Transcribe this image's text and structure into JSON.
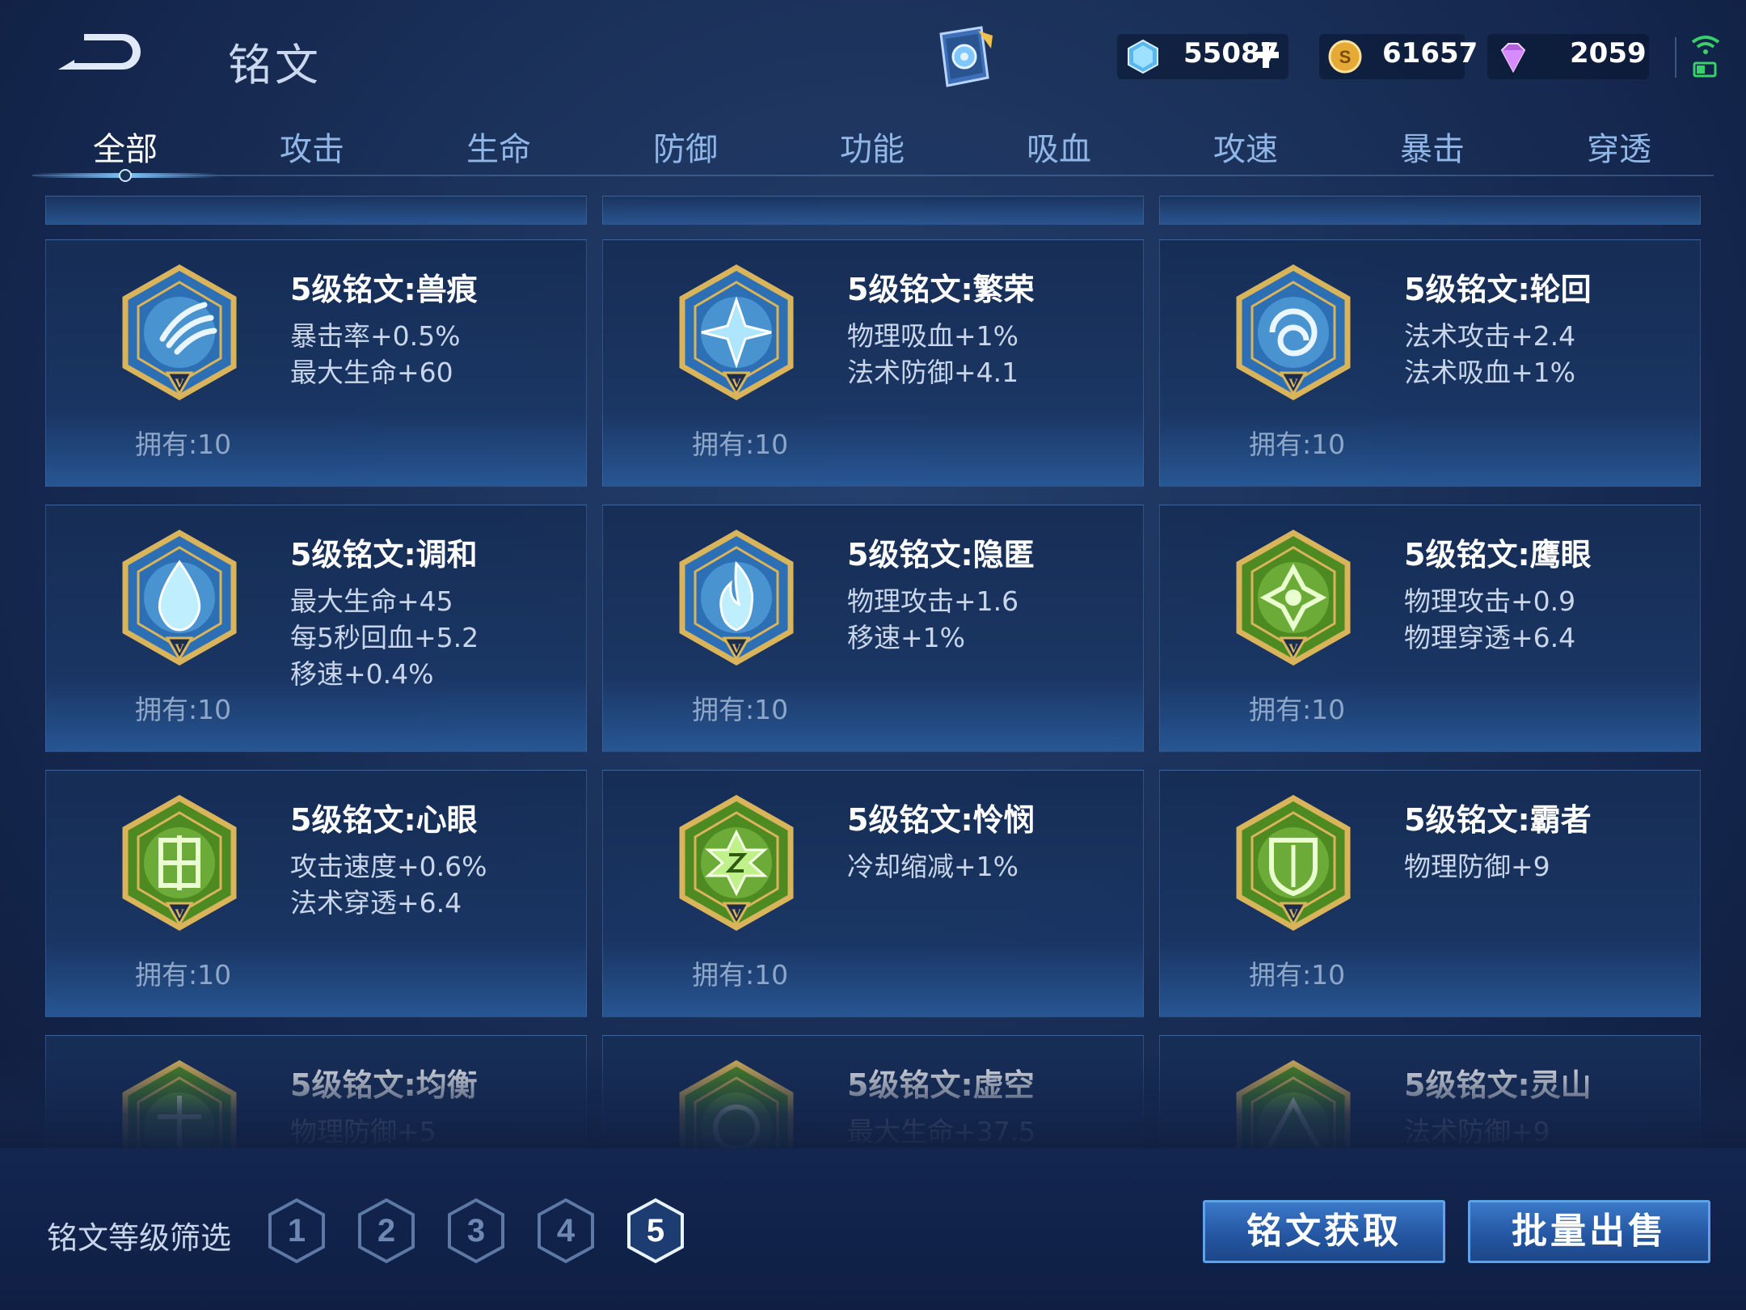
{
  "header": {
    "title": "铭文",
    "currencies": [
      {
        "icon": "diamond-crystal-icon",
        "value": "55087",
        "has_plus": true
      },
      {
        "icon": "gold-coin-icon",
        "value": "61657",
        "has_plus": false
      },
      {
        "icon": "purple-gem-icon",
        "value": "2059",
        "has_plus": false
      }
    ]
  },
  "tabs": [
    {
      "label": "全部",
      "active": true
    },
    {
      "label": "攻击"
    },
    {
      "label": "生命"
    },
    {
      "label": "防御"
    },
    {
      "label": "功能"
    },
    {
      "label": "吸血"
    },
    {
      "label": "攻速"
    },
    {
      "label": "暴击"
    },
    {
      "label": "穿透"
    }
  ],
  "cards": [
    {
      "name": "5级铭文:兽痕",
      "attrs": [
        "暴击率+0.5%",
        "最大生命+60"
      ],
      "owned": "拥有:10",
      "color": "blue",
      "icon": "claw-marks-icon"
    },
    {
      "name": "5级铭文:繁荣",
      "attrs": [
        "物理吸血+1%",
        "法术防御+4.1"
      ],
      "owned": "拥有:10",
      "color": "blue",
      "icon": "star-compass-icon"
    },
    {
      "name": "5级铭文:轮回",
      "attrs": [
        "法术攻击+2.4",
        "法术吸血+1%"
      ],
      "owned": "拥有:10",
      "color": "blue",
      "icon": "swirl-icon"
    },
    {
      "name": "5级铭文:调和",
      "attrs": [
        "最大生命+45",
        "每5秒回血+5.2",
        "移速+0.4%"
      ],
      "owned": "拥有:10",
      "color": "blue",
      "icon": "water-drop-icon"
    },
    {
      "name": "5级铭文:隐匿",
      "attrs": [
        "物理攻击+1.6",
        "移速+1%"
      ],
      "owned": "拥有:10",
      "color": "blue",
      "icon": "flame-icon"
    },
    {
      "name": "5级铭文:鹰眼",
      "attrs": [
        "物理攻击+0.9",
        "物理穿透+6.4"
      ],
      "owned": "拥有:10",
      "color": "green",
      "icon": "crosshair-icon"
    },
    {
      "name": "5级铭文:心眼",
      "attrs": [
        "攻击速度+0.6%",
        "法术穿透+6.4"
      ],
      "owned": "拥有:10",
      "color": "green",
      "icon": "rune-glyph-icon"
    },
    {
      "name": "5级铭文:怜悯",
      "attrs": [
        "冷却缩减+1%"
      ],
      "owned": "拥有:10",
      "color": "green",
      "icon": "hourglass-star-icon"
    },
    {
      "name": "5级铭文:霸者",
      "attrs": [
        "物理防御+9"
      ],
      "owned": "拥有:10",
      "color": "green",
      "icon": "shield-icon"
    },
    {
      "name": "5级铭文:均衡",
      "attrs": [
        "物理防御+5"
      ],
      "owned": "",
      "color": "green",
      "icon": "balance-icon"
    },
    {
      "name": "5级铭文:虚空",
      "attrs": [
        "最大生命+37.5"
      ],
      "owned": "",
      "color": "green",
      "icon": "void-icon"
    },
    {
      "name": "5级铭文:灵山",
      "attrs": [
        "法术防御+9"
      ],
      "owned": "",
      "color": "green",
      "icon": "mountain-icon"
    }
  ],
  "footer": {
    "filter_label": "铭文等级筛选",
    "levels": [
      "1",
      "2",
      "3",
      "4",
      "5"
    ],
    "selected_level": "5",
    "obtain_button": "铭文获取",
    "bulk_sell_button": "批量出售"
  },
  "colors": {
    "blue_badge": "#2d6fb5",
    "green_badge": "#4d8a22",
    "gold_frame": "#d9b45a",
    "button_blue": "#2a5ca8"
  }
}
